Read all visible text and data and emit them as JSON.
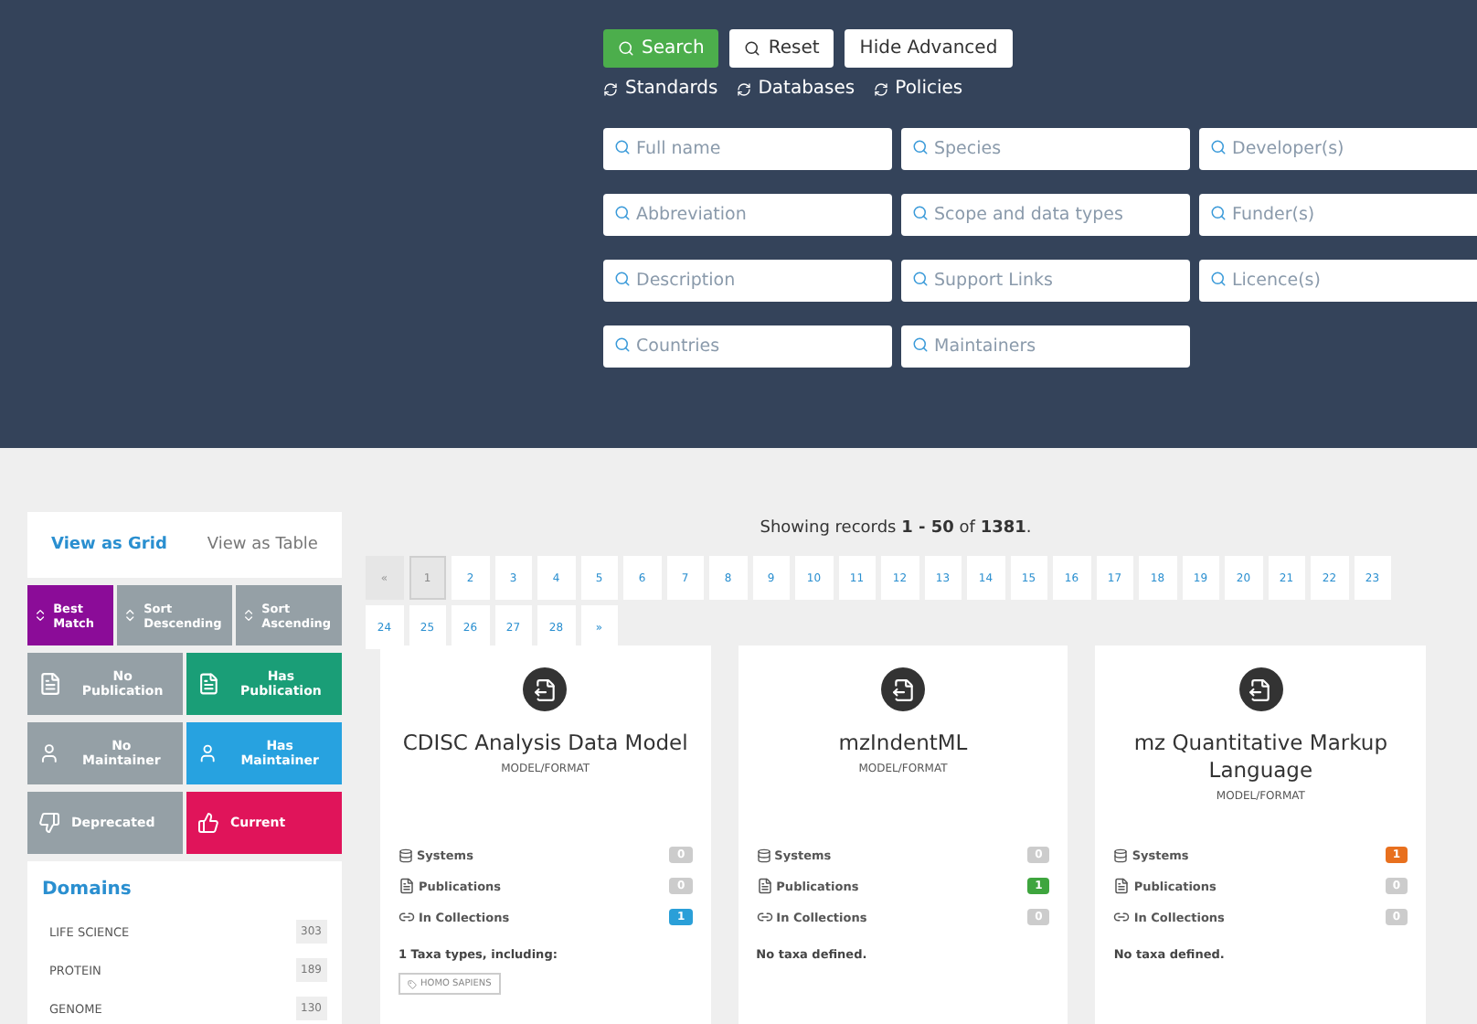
{
  "search": {
    "buttons": [
      {
        "label": "Search",
        "kind": "primary"
      },
      {
        "label": "Reset",
        "kind": "reset"
      },
      {
        "label": "Hide Advanced",
        "kind": "plain"
      }
    ],
    "types": [
      "Standards",
      "Databases",
      "Policies"
    ],
    "fields": [
      {
        "placeholder": "Full name"
      },
      {
        "placeholder": "Species"
      },
      {
        "placeholder": "Developer(s)"
      },
      {
        "placeholder": "Abbreviation"
      },
      {
        "placeholder": "Scope and data types"
      },
      {
        "placeholder": "Funder(s)"
      },
      {
        "placeholder": "Description"
      },
      {
        "placeholder": "Support Links"
      },
      {
        "placeholder": "Licence(s)"
      },
      {
        "placeholder": "Countries"
      },
      {
        "placeholder": "Maintainers"
      }
    ]
  },
  "sidebar": {
    "views": [
      {
        "label": "View as Grid",
        "selected": true
      },
      {
        "label": "View as Table",
        "selected": false
      }
    ],
    "sorts": [
      {
        "label": "Best Match",
        "selected": true
      },
      {
        "label": "Sort Descending",
        "selected": false
      },
      {
        "label": "Sort Ascending",
        "selected": false
      }
    ],
    "filters": [
      {
        "label": "No Publication",
        "kind": "publication",
        "selected": false
      },
      {
        "label": "Has Publication",
        "kind": "publication",
        "selected": true,
        "color": "#1a9e77"
      },
      {
        "label": "No Maintainer",
        "kind": "maintainer",
        "selected": false
      },
      {
        "label": "Has Maintainer",
        "kind": "maintainer",
        "selected": true,
        "color": "#27a2e0"
      },
      {
        "label": "Deprecated",
        "kind": "deprecated",
        "selected": false
      },
      {
        "label": "Current",
        "kind": "current",
        "selected": true,
        "color": "#e0145a"
      }
    ],
    "domains": {
      "title": "Domains",
      "items": [
        {
          "name": "LIFE SCIENCE",
          "count": "303"
        },
        {
          "name": "PROTEIN",
          "count": "189"
        },
        {
          "name": "GENOME",
          "count": "130"
        }
      ]
    }
  },
  "results": {
    "summary": "Showing records **1 - 50** of **1381**.",
    "pages": [
      {
        "label": "«",
        "selected": false,
        "disabled": true
      },
      {
        "label": "1",
        "selected": true,
        "disabled": false
      },
      {
        "label": "2",
        "selected": false,
        "disabled": false
      },
      {
        "label": "3",
        "selected": false,
        "disabled": false
      },
      {
        "label": "4",
        "selected": false,
        "disabled": false
      },
      {
        "label": "5",
        "selected": false,
        "disabled": false
      },
      {
        "label": "6",
        "selected": false,
        "disabled": false
      },
      {
        "label": "7",
        "selected": false,
        "disabled": false
      },
      {
        "label": "8",
        "selected": false,
        "disabled": false
      },
      {
        "label": "9",
        "selected": false,
        "disabled": false
      },
      {
        "label": "10",
        "selected": false,
        "disabled": false
      },
      {
        "label": "11",
        "selected": false,
        "disabled": false
      },
      {
        "label": "12",
        "selected": false,
        "disabled": false
      },
      {
        "label": "13",
        "selected": false,
        "disabled": false
      },
      {
        "label": "14",
        "selected": false,
        "disabled": false
      },
      {
        "label": "15",
        "selected": false,
        "disabled": false
      },
      {
        "label": "16",
        "selected": false,
        "disabled": false
      },
      {
        "label": "17",
        "selected": false,
        "disabled": false
      },
      {
        "label": "18",
        "selected": false,
        "disabled": false
      },
      {
        "label": "19",
        "selected": false,
        "disabled": false
      },
      {
        "label": "20",
        "selected": false,
        "disabled": false
      },
      {
        "label": "21",
        "selected": false,
        "disabled": false
      },
      {
        "label": "22",
        "selected": false,
        "disabled": false
      },
      {
        "label": "23",
        "selected": false,
        "disabled": false
      },
      {
        "label": "24",
        "selected": false,
        "disabled": false
      },
      {
        "label": "25",
        "selected": false,
        "disabled": false
      },
      {
        "label": "26",
        "selected": false,
        "disabled": false
      },
      {
        "label": "27",
        "selected": false,
        "disabled": false
      },
      {
        "label": "28",
        "selected": false,
        "disabled": false
      },
      {
        "label": "»",
        "selected": false,
        "disabled": false
      }
    ],
    "cards": [
      {
        "title": "CDISC Analysis Data Model",
        "type": "MODEL/FORMAT",
        "stats": [
          {
            "kind": "systems",
            "label": "Systems",
            "count": "0",
            "color": "#cccccc"
          },
          {
            "kind": "publications",
            "label": "Publications",
            "count": "0",
            "color": "#cccccc"
          },
          {
            "kind": "collections",
            "label": "In Collections",
            "count": "1",
            "color": "#2a9fd8"
          }
        ],
        "taxa": "1 Taxa types, including:",
        "tags": [
          "HOMO SAPIENS"
        ]
      },
      {
        "title": "mzIndentML",
        "type": "MODEL/FORMAT",
        "stats": [
          {
            "kind": "systems",
            "label": "Systems",
            "count": "0",
            "color": "#cccccc"
          },
          {
            "kind": "publications",
            "label": "Publications",
            "count": "1",
            "color": "#3ea53e"
          },
          {
            "kind": "collections",
            "label": "In Collections",
            "count": "0",
            "color": "#cccccc"
          }
        ],
        "taxa": "No taxa defined."
      },
      {
        "title": "mz Quantitative Markup Language",
        "type": "MODEL/FORMAT",
        "stats": [
          {
            "kind": "systems",
            "label": "Systems",
            "count": "1",
            "color": "#e8701e"
          },
          {
            "kind": "publications",
            "label": "Publications",
            "count": "0",
            "color": "#cccccc"
          },
          {
            "kind": "collections",
            "label": "In Collections",
            "count": "0",
            "color": "#cccccc"
          }
        ],
        "taxa": "No taxa defined."
      }
    ]
  }
}
